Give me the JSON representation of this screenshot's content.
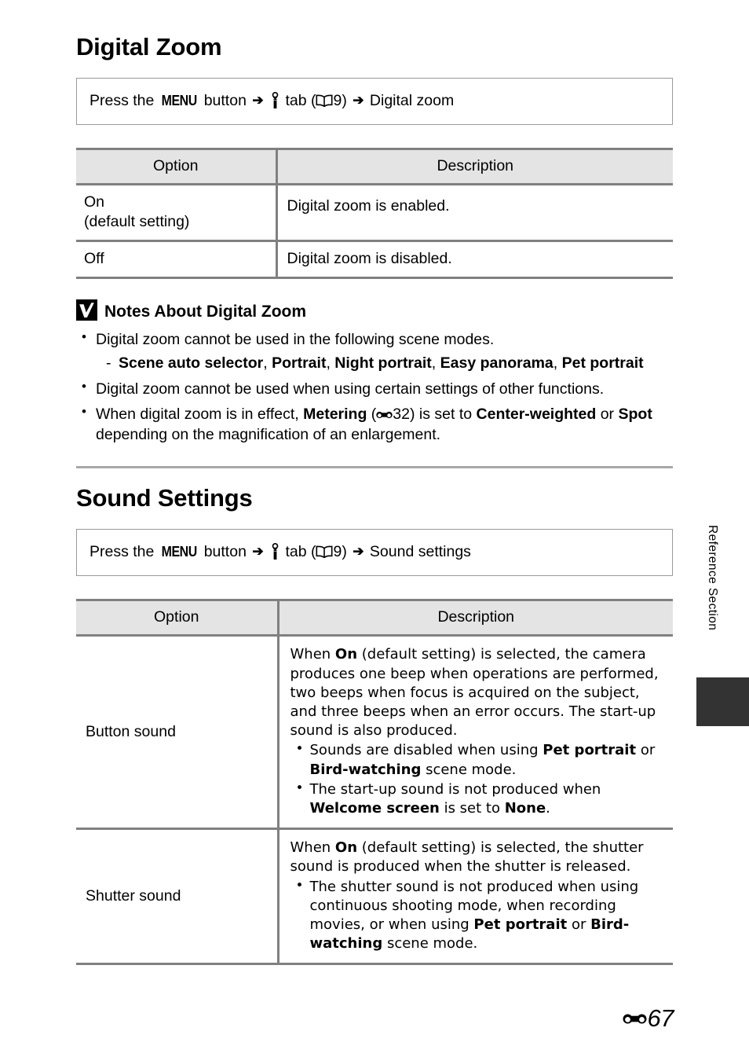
{
  "page": {
    "number_prefix_icon": "reference-section-icon",
    "number": "67",
    "side_tab_label": "Reference Section"
  },
  "sections": [
    {
      "id": "digital-zoom",
      "title": "Digital Zoom",
      "nav": {
        "prefix": "Press the",
        "menu_button": "MENU",
        "after_menu": "button",
        "arrow": "➔",
        "tab_icon": "setup-wrench-icon",
        "tab_word": "tab",
        "ref_open": "(",
        "book_icon": "manual-book-icon",
        "ref_page": "9",
        "ref_close": ")",
        "destination": "Digital zoom"
      },
      "table": {
        "headers": [
          "Option",
          "Description"
        ],
        "rows": [
          {
            "option_line1": "On",
            "option_line2": "(default setting)",
            "description": "Digital zoom is enabled."
          },
          {
            "option_line1": "Off",
            "option_line2": "",
            "description": "Digital zoom is disabled."
          }
        ]
      },
      "notes": {
        "icon": "caution-check-icon",
        "heading": "Notes About Digital Zoom",
        "items": [
          {
            "text": "Digital zoom cannot be used in the following scene modes.",
            "sub": [
              "Scene auto selector",
              "Portrait",
              "Night portrait",
              "Easy panorama",
              "Pet portrait"
            ]
          },
          {
            "text": "Digital zoom cannot be used when using certain settings of other functions.",
            "sub": []
          }
        ],
        "metering_note": {
          "part1": "When digital zoom is in effect, ",
          "bold1": "Metering",
          "part2": " (",
          "ref_icon": "reference-section-icon",
          "ref_page": "32",
          "part3": ") is set to ",
          "bold2": "Center-weighted",
          "part4": " or ",
          "bold3": "Spot",
          "part5": " depending on the magnification of an enlargement."
        }
      }
    },
    {
      "id": "sound-settings",
      "title": "Sound Settings",
      "nav": {
        "prefix": "Press the",
        "menu_button": "MENU",
        "after_menu": "button",
        "arrow": "➔",
        "tab_icon": "setup-wrench-icon",
        "tab_word": "tab",
        "ref_open": "(",
        "book_icon": "manual-book-icon",
        "ref_page": "9",
        "ref_close": ")",
        "destination": "Sound settings"
      },
      "table": {
        "headers": [
          "Option",
          "Description"
        ],
        "rows": [
          {
            "option": "Button sound",
            "intro": {
              "p1": "When ",
              "b1": "On",
              "p2": " (default setting) is selected, the camera produces one beep when operations are performed, two beeps when focus is acquired on the subject, and three beeps when an error occurs. The start-up sound is also produced."
            },
            "bullets": [
              {
                "p1": "Sounds are disabled when using ",
                "b1": "Pet portrait",
                "p2": " or ",
                "b2": "Bird-watching",
                "p3": " scene mode."
              },
              {
                "p1": "The start-up sound is not produced when ",
                "b1": "Welcome screen",
                "p2": " is set to ",
                "b2": "None",
                "p3": "."
              }
            ]
          },
          {
            "option": "Shutter sound",
            "intro": {
              "p1": "When ",
              "b1": "On",
              "p2": " (default setting) is selected, the shutter sound is produced when the shutter is released."
            },
            "bullets": [
              {
                "p1": "The shutter sound is not produced when using continuous shooting mode, when recording movies, or when using ",
                "b1": "Pet portrait",
                "p2": " or ",
                "b2": "Bird-watching",
                "p3": " scene mode."
              }
            ]
          }
        ]
      }
    }
  ],
  "colors": {
    "header_band": "#e4e4e4",
    "rule": "#808080",
    "nav_border": "#9a9a9a",
    "divider": "#a8a8a8",
    "side_tab": "#333333"
  }
}
